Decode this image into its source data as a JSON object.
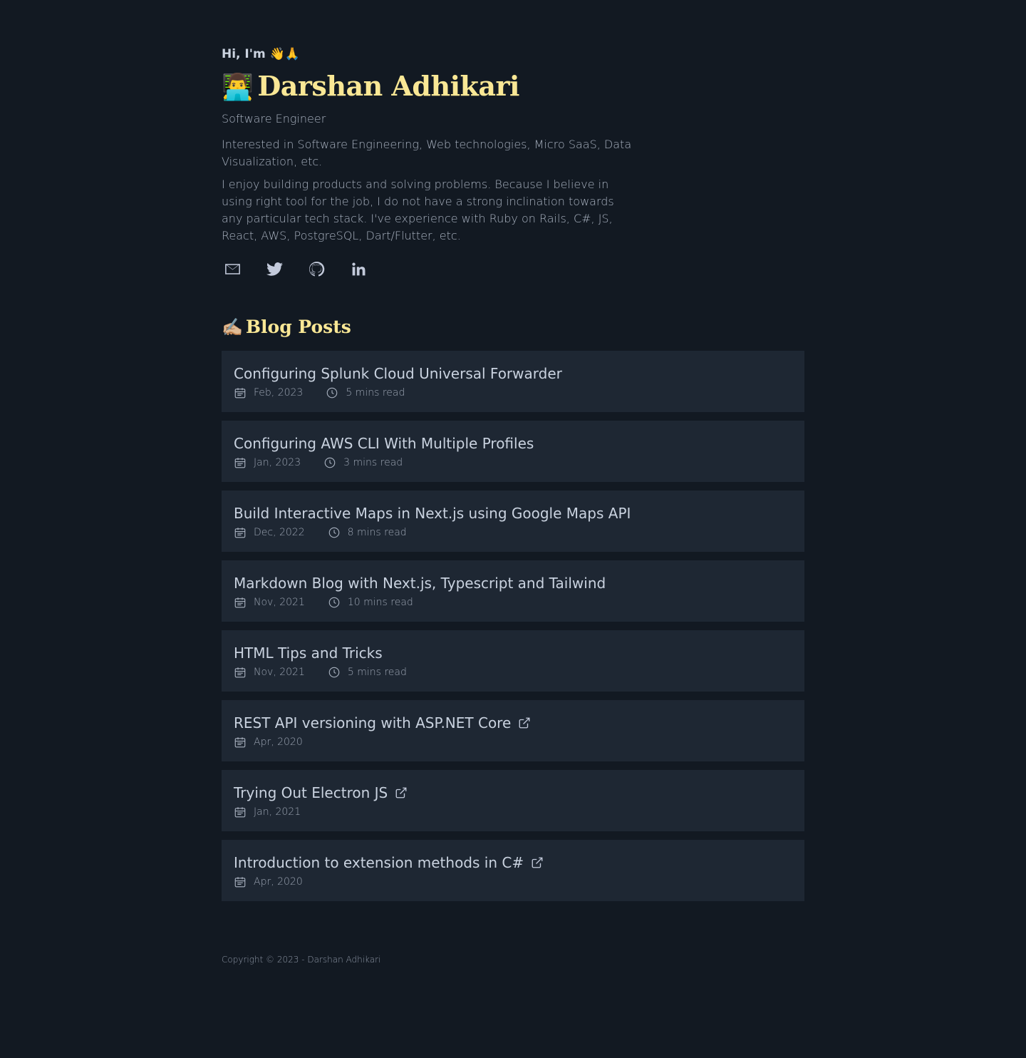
{
  "intro": {
    "greeting": "Hi, I'm 👋🙏",
    "avatar_emoji": "👨‍💻",
    "name": "Darshan Adhikari",
    "role": "Software Engineer",
    "interests": "Interested in Software Engineering, Web technologies, Micro SaaS, Data Visualization, etc.",
    "about": "I enjoy building products and solving problems. Because I believe in using right tool for the job, I do not have a strong inclination towards any particular tech stack. I've experience with Ruby on Rails, C#, JS, React, AWS, PostgreSQL, Dart/Flutter, etc."
  },
  "socials": [
    {
      "name": "email-icon"
    },
    {
      "name": "twitter-icon"
    },
    {
      "name": "github-icon"
    },
    {
      "name": "linkedin-icon"
    }
  ],
  "blog": {
    "emoji": "✍🏼",
    "title": "Blog Posts",
    "posts": [
      {
        "title": "Configuring Splunk Cloud Universal Forwarder",
        "date": "Feb, 2023",
        "read_time": "5 mins read",
        "external": false
      },
      {
        "title": "Configuring AWS CLI With Multiple Profiles",
        "date": "Jan, 2023",
        "read_time": "3 mins read",
        "external": false
      },
      {
        "title": "Build Interactive Maps in Next.js using Google Maps API",
        "date": "Dec, 2022",
        "read_time": "8 mins read",
        "external": false
      },
      {
        "title": "Markdown Blog with Next.js, Typescript and Tailwind",
        "date": "Nov, 2021",
        "read_time": "10 mins read",
        "external": false
      },
      {
        "title": "HTML Tips and Tricks",
        "date": "Nov, 2021",
        "read_time": "5 mins read",
        "external": false
      },
      {
        "title": "REST API versioning with ASP.NET Core",
        "date": "Apr, 2020",
        "read_time": "",
        "external": true
      },
      {
        "title": "Trying Out Electron JS",
        "date": "Jan, 2021",
        "read_time": "",
        "external": true
      },
      {
        "title": "Introduction to extension methods in C#",
        "date": "Apr, 2020",
        "read_time": "",
        "external": true
      }
    ]
  },
  "footer": {
    "copyright": "Copyright © 2023 - Darshan Adhikari"
  }
}
